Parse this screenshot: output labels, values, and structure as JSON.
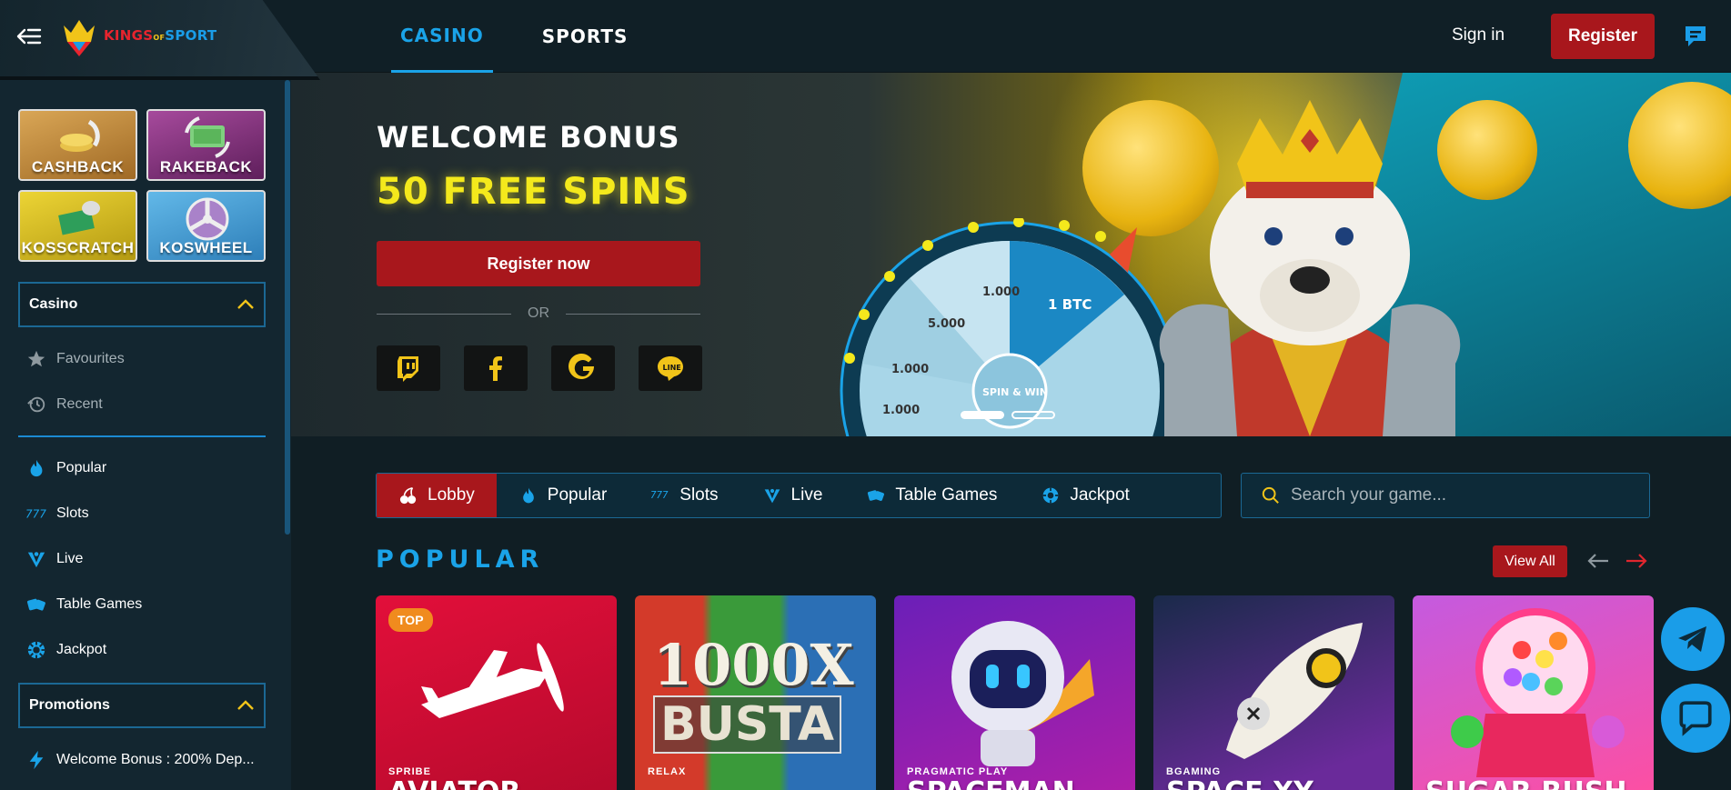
{
  "header": {
    "logo_text_kings": "KINGS",
    "logo_text_of": "OF",
    "logo_text_sport": "SPORT",
    "tabs": [
      {
        "label": "CASINO",
        "active": true
      },
      {
        "label": "SPORTS",
        "active": false
      }
    ],
    "signin_label": "Sign in",
    "register_label": "Register"
  },
  "sidebar": {
    "promo_tiles": [
      {
        "label": "CASHBACK"
      },
      {
        "label": "RAKEBACK"
      },
      {
        "label": "KOSSCRATCH"
      },
      {
        "label": "KOSWHEEL"
      }
    ],
    "casino_section": "Casino",
    "casino_items": [
      {
        "label": "Favourites",
        "icon": "star-icon"
      },
      {
        "label": "Recent",
        "icon": "history-icon"
      }
    ],
    "category_items": [
      {
        "label": "Popular",
        "icon": "flame-icon"
      },
      {
        "label": "Slots",
        "icon": "slots-777-icon"
      },
      {
        "label": "Live",
        "icon": "live-icon"
      },
      {
        "label": "Table Games",
        "icon": "dice-icon"
      },
      {
        "label": "Jackpot",
        "icon": "jackpot-icon"
      }
    ],
    "promotions_section": "Promotions",
    "promotion_items": [
      {
        "label": "Welcome Bonus : 200% Dep...",
        "icon": "lightning-icon"
      }
    ]
  },
  "hero": {
    "title": "WELCOME BONUS",
    "subtitle": "50 FREE SPINS",
    "register_now": "Register now",
    "or": "OR",
    "social": [
      {
        "name": "twitch-icon"
      },
      {
        "name": "facebook-icon"
      },
      {
        "name": "google-icon"
      },
      {
        "name": "line-icon"
      }
    ],
    "wheel_labels": [
      "1 BTC",
      "1.000",
      "5.000",
      "1.000",
      "1.000"
    ],
    "wheel_center": "SPIN & WIN",
    "slides": 2,
    "active_slide": 1
  },
  "categories": [
    {
      "label": "Lobby",
      "icon": "cherry-icon",
      "active": true
    },
    {
      "label": "Popular",
      "icon": "flame-icon",
      "active": false
    },
    {
      "label": "Slots",
      "icon": "slots-777-icon",
      "active": false
    },
    {
      "label": "Live",
      "icon": "live-icon",
      "active": false
    },
    {
      "label": "Table Games",
      "icon": "dice-icon",
      "active": false
    },
    {
      "label": "Jackpot",
      "icon": "jackpot-icon",
      "active": false
    }
  ],
  "search": {
    "placeholder": "Search your game..."
  },
  "popular": {
    "title": "POPULAR",
    "view_all": "View All",
    "games": [
      {
        "name": "AVIATOR",
        "provider": "SPRIBE",
        "badge": "TOP"
      },
      {
        "name": "1000X BUSTA",
        "provider": "RELAX",
        "badge": ""
      },
      {
        "name": "SPACEMAN",
        "provider": "PRAGMATIC PLAY",
        "badge": ""
      },
      {
        "name": "SPACE XY",
        "provider": "BGAMING",
        "badge": ""
      },
      {
        "name": "SUGAR RUSH",
        "provider": "",
        "badge": ""
      }
    ]
  },
  "colors": {
    "accent_blue": "#1aa3e8",
    "accent_red": "#a8171c",
    "hero_yellow": "#f4e91c",
    "background": "#101e24"
  }
}
